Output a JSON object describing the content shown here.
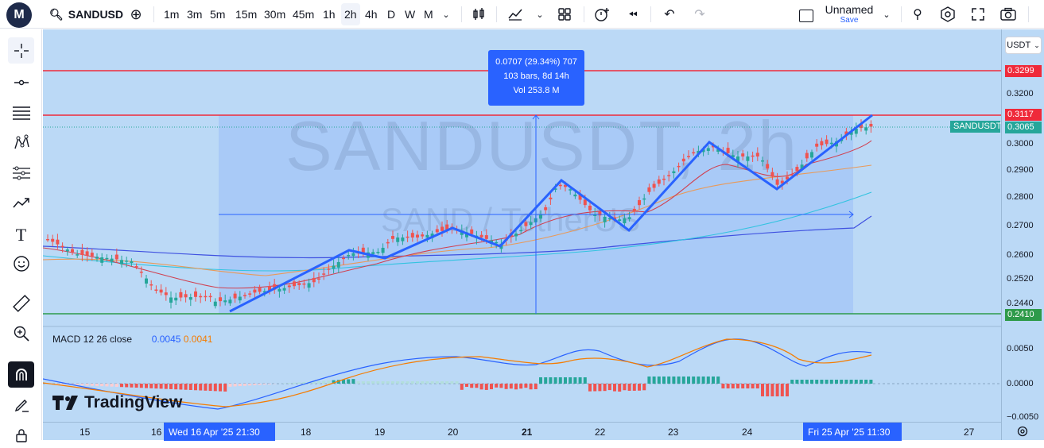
{
  "topbar": {
    "logo_letter": "M",
    "symbol": "SANDUSD",
    "timeframes": [
      "1m",
      "3m",
      "5m",
      "15m",
      "30m",
      "45m",
      "1h",
      "2h",
      "4h",
      "D",
      "W",
      "M"
    ],
    "active_timeframe": "2h",
    "layout_name": "Unnamed",
    "layout_save": "Save"
  },
  "chart": {
    "watermark_symbol": "SANDUSDT, 2h",
    "watermark_name": "SAND / TetherUS",
    "currency": "USDT",
    "symbol_tag": "SANDUSDT",
    "measure_tooltip": {
      "line1": "0.0707 (29.34%) 707",
      "line2": "103 bars, 8d 14h",
      "line3": "Vol 253.8 M"
    },
    "price_ticks": [
      "0.3200",
      "0.3000",
      "0.2900",
      "0.2800",
      "0.2700",
      "0.2600",
      "0.2520",
      "0.2440"
    ],
    "price_badges": {
      "upper_red": "0.3299",
      "mid_red": "0.3117",
      "last": "0.3065",
      "lower_green": "0.2410"
    },
    "macd": {
      "label": "MACD 12 26 close",
      "value1": "0.0045",
      "value2": "0.0041",
      "ticks": [
        "0.0050",
        "0.0000",
        "−0.0050"
      ]
    },
    "x_labels": [
      "15",
      "16",
      "18",
      "19",
      "20",
      "21",
      "22",
      "23",
      "24",
      "27"
    ],
    "x_highlight_start": "Wed 16 Apr '25   21:30",
    "x_highlight_end": "Fri 25 Apr '25   11:30",
    "brand": "TradingView",
    "colors": {
      "up": "#26a69a",
      "down": "#ef5350",
      "accent": "#2962ff",
      "background": "#bbd9f6"
    }
  }
}
